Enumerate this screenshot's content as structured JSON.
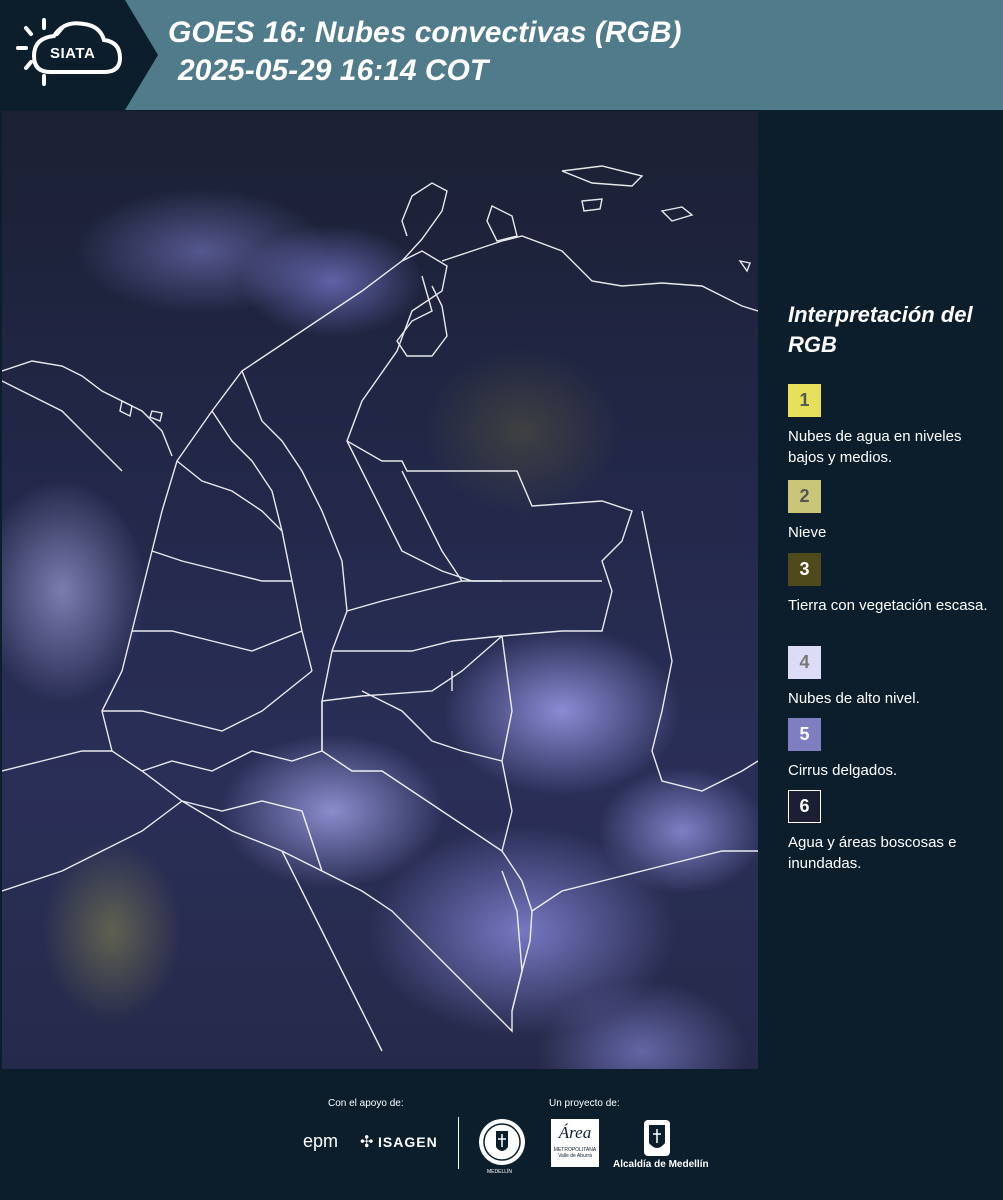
{
  "header": {
    "logo_text": "SIATA",
    "title_line1": "GOES 16: Nubes convectivas (RGB)",
    "title_line2": "2025-05-29 16:14 COT"
  },
  "map": {
    "image_description_icon": "satellite-map"
  },
  "legend": {
    "title": "Interpretación del RGB",
    "items": [
      {
        "number": "1",
        "label": "Nubes de agua en niveles bajos y medios.",
        "color": "#e6e05a",
        "text_color": "#555"
      },
      {
        "number": "2",
        "label": "Nieve",
        "color": "#c9c67a",
        "text_color": "#555"
      },
      {
        "number": "3",
        "label": "Tierra con vegetación escasa.",
        "color": "#4f4a1c",
        "text_color": "#fff"
      },
      {
        "number": "4",
        "label": "Nubes de alto nivel.",
        "color": "#dcdcf6",
        "text_color": "#777"
      },
      {
        "number": "5",
        "label": "Cirrus delgados.",
        "color": "#7e7ec0",
        "text_color": "#fff"
      },
      {
        "number": "6",
        "label": "Agua y áreas boscosas e inundadas.",
        "color": "#1a1f33",
        "text_color": "#fff"
      }
    ]
  },
  "footer": {
    "support_label": "Con el apoyo de:",
    "project_label": "Un proyecto de:",
    "sponsor_epm": "epm",
    "sponsor_isagen": "ISAGEN",
    "area_line1": "Área",
    "area_line2": "METROPOLITANA",
    "area_line3": "Valle de Aburrá",
    "alcaldia": "Alcaldía de Medellín",
    "medellin_seal_text": "MEDELLÍN"
  }
}
